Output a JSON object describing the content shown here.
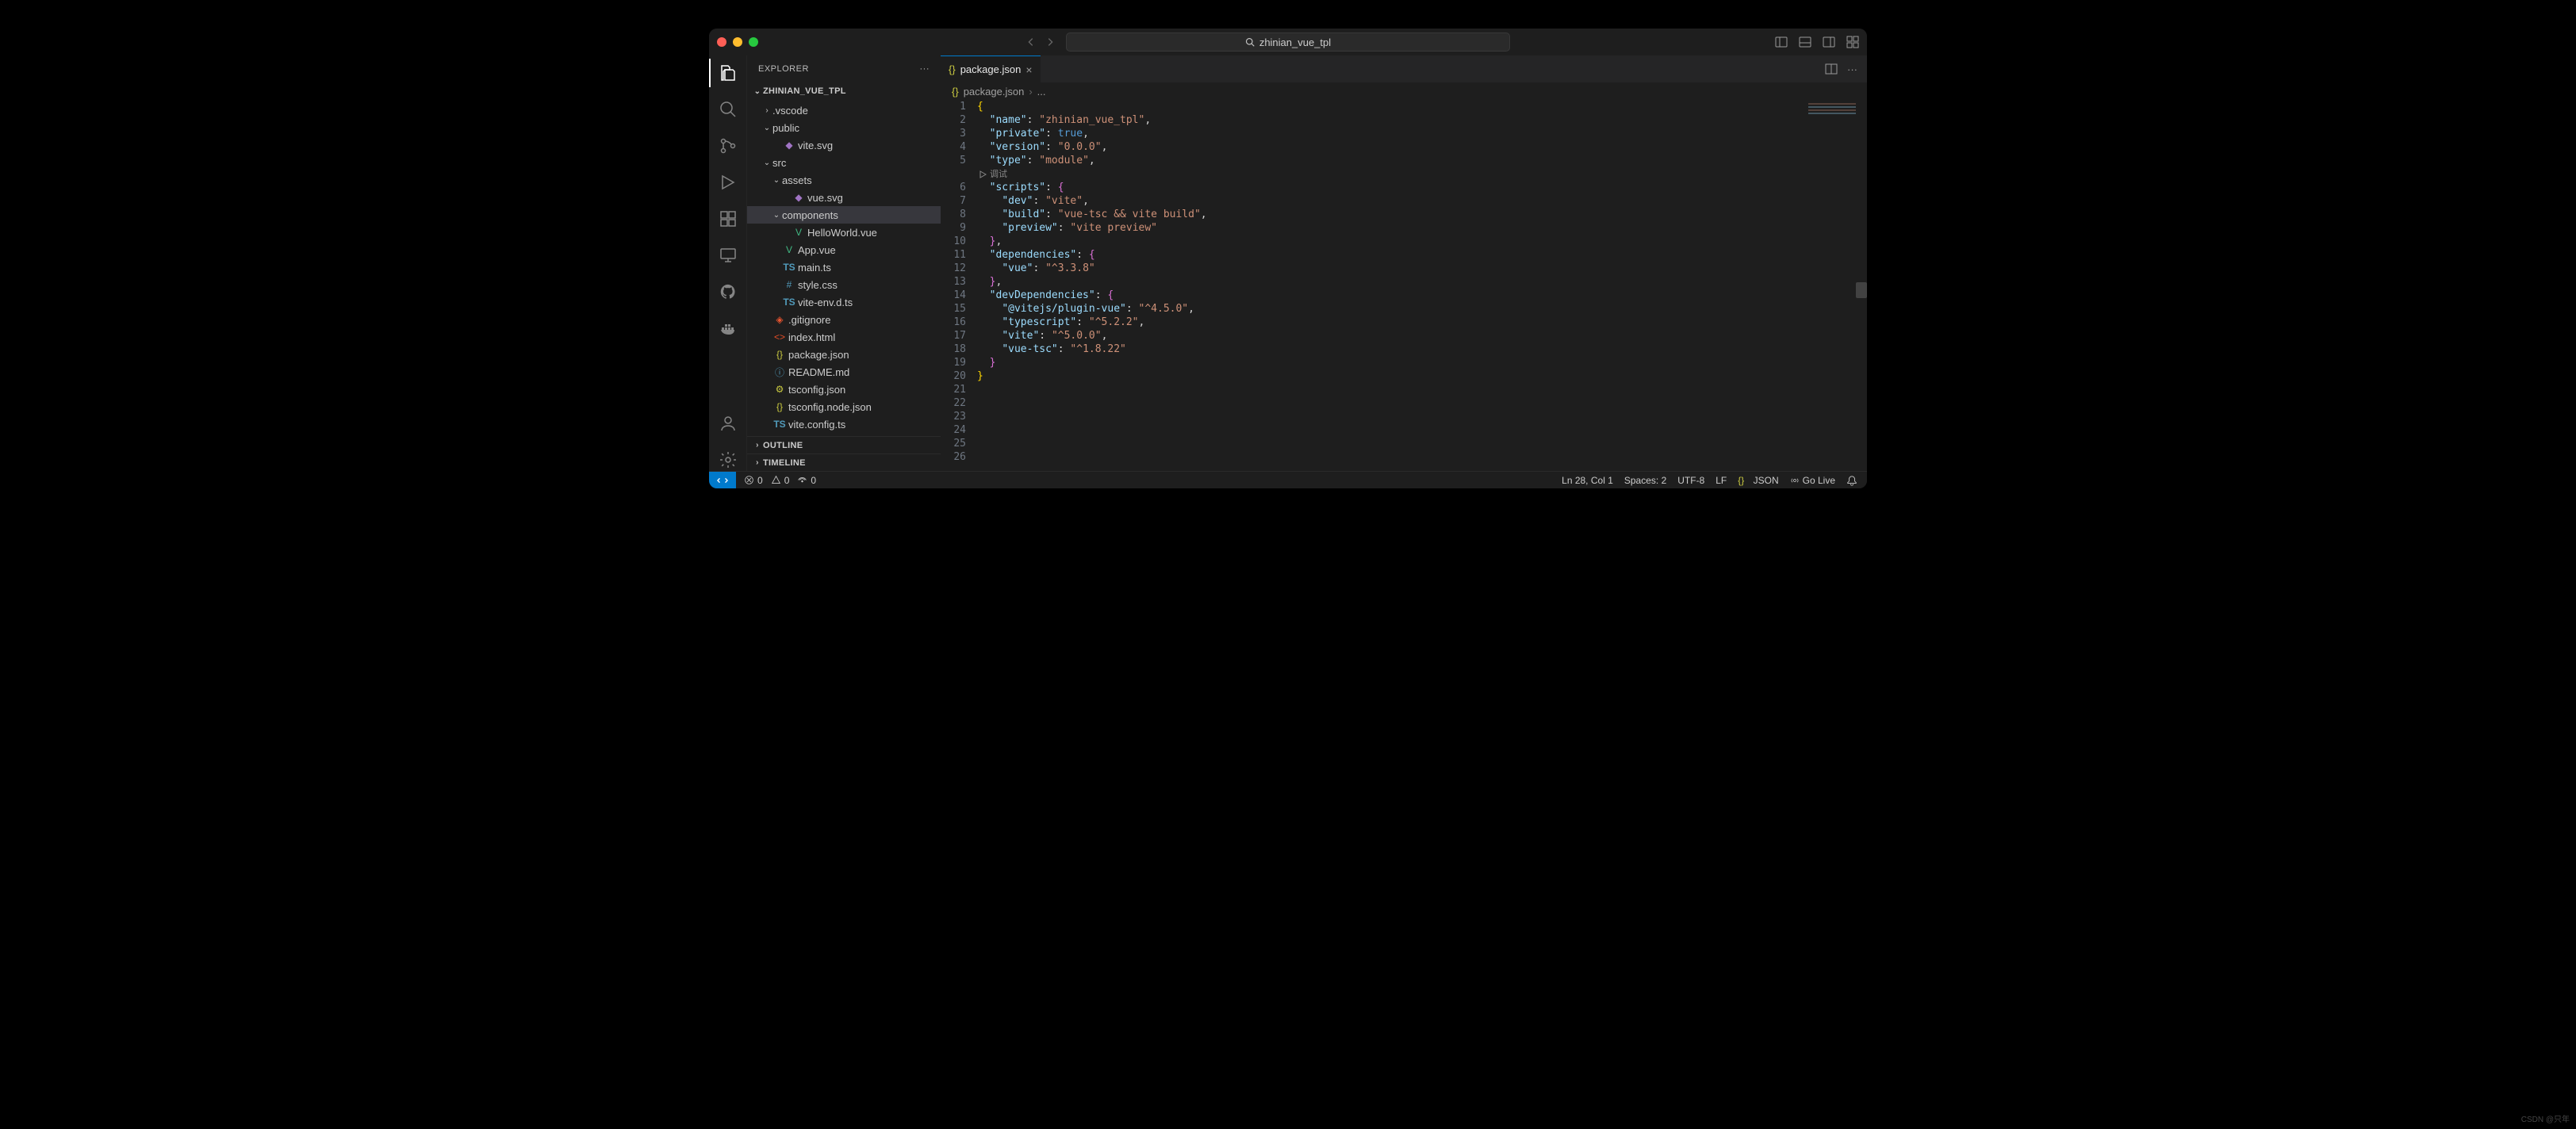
{
  "title": "zhinian_vue_tpl",
  "sidebar": {
    "header": "EXPLORER",
    "root": "ZHINIAN_VUE_TPL",
    "tree": [
      {
        "name": ".vscode",
        "type": "folder",
        "expanded": false,
        "depth": 1
      },
      {
        "name": "public",
        "type": "folder",
        "expanded": true,
        "depth": 1
      },
      {
        "name": "vite.svg",
        "type": "svg",
        "depth": 2
      },
      {
        "name": "src",
        "type": "folder",
        "expanded": true,
        "depth": 1
      },
      {
        "name": "assets",
        "type": "folder",
        "expanded": true,
        "depth": 2
      },
      {
        "name": "vue.svg",
        "type": "svg",
        "depth": 3
      },
      {
        "name": "components",
        "type": "folder",
        "expanded": true,
        "depth": 2,
        "selected": true
      },
      {
        "name": "HelloWorld.vue",
        "type": "vue",
        "depth": 3
      },
      {
        "name": "App.vue",
        "type": "vue",
        "depth": 2
      },
      {
        "name": "main.ts",
        "type": "ts",
        "depth": 2
      },
      {
        "name": "style.css",
        "type": "css",
        "depth": 2
      },
      {
        "name": "vite-env.d.ts",
        "type": "ts",
        "depth": 2
      },
      {
        "name": ".gitignore",
        "type": "git",
        "depth": 1
      },
      {
        "name": "index.html",
        "type": "html",
        "depth": 1
      },
      {
        "name": "package.json",
        "type": "json",
        "depth": 1
      },
      {
        "name": "README.md",
        "type": "md",
        "depth": 1
      },
      {
        "name": "tsconfig.json",
        "type": "jsoncfg",
        "depth": 1
      },
      {
        "name": "tsconfig.node.json",
        "type": "json",
        "depth": 1
      },
      {
        "name": "vite.config.ts",
        "type": "ts",
        "depth": 1
      }
    ],
    "bottom": [
      "OUTLINE",
      "TIMELINE"
    ]
  },
  "tab": {
    "label": "package.json"
  },
  "breadcrumb": {
    "file": "package.json",
    "rest": "..."
  },
  "debug_lens": "调试",
  "code_lines": 26,
  "status": {
    "errors": "0",
    "warnings": "0",
    "ports": "0",
    "ln_col": "Ln 28, Col 1",
    "spaces": "Spaces: 2",
    "encoding": "UTF-8",
    "eol": "LF",
    "lang": "JSON",
    "golive": "Go Live"
  },
  "package_json": {
    "name": "zhinian_vue_tpl",
    "private": true,
    "version": "0.0.0",
    "type": "module",
    "scripts": {
      "dev": "vite",
      "build": "vue-tsc && vite build",
      "preview": "vite preview"
    },
    "dependencies": {
      "vue": "^3.3.8"
    },
    "devDependencies": {
      "@vitejs/plugin-vue": "^4.5.0",
      "typescript": "^5.2.2",
      "vite": "^5.0.0",
      "vue-tsc": "^1.8.22"
    }
  },
  "watermark": "CSDN @只年"
}
